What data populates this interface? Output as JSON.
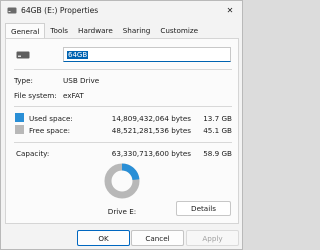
{
  "window": {
    "title": "64GB (E:) Properties",
    "close_glyph": "✕"
  },
  "tabs": [
    {
      "label": "General",
      "active": true
    },
    {
      "label": "Tools",
      "active": false
    },
    {
      "label": "Hardware",
      "active": false
    },
    {
      "label": "Sharing",
      "active": false
    },
    {
      "label": "Customize",
      "active": false
    }
  ],
  "general": {
    "drive_name": "64GB",
    "type_label": "Type:",
    "type_value": "USB Drive",
    "fs_label": "File system:",
    "fs_value": "exFAT",
    "used_label": "Used space:",
    "used_bytes": "14,809,432,064 bytes",
    "used_size": "13.7 GB",
    "free_label": "Free space:",
    "free_bytes": "48,521,281,536 bytes",
    "free_size": "45.1 GB",
    "capacity_label": "Capacity:",
    "capacity_bytes": "63,330,713,600 bytes",
    "capacity_size": "58.9 GB",
    "drive_label": "Drive E:",
    "details_label": "Details",
    "used_fraction": 0.234
  },
  "colors": {
    "used": "#2a8fd6",
    "free": "#b8b8b8"
  },
  "footer": {
    "ok": "OK",
    "cancel": "Cancel",
    "apply": "Apply"
  }
}
